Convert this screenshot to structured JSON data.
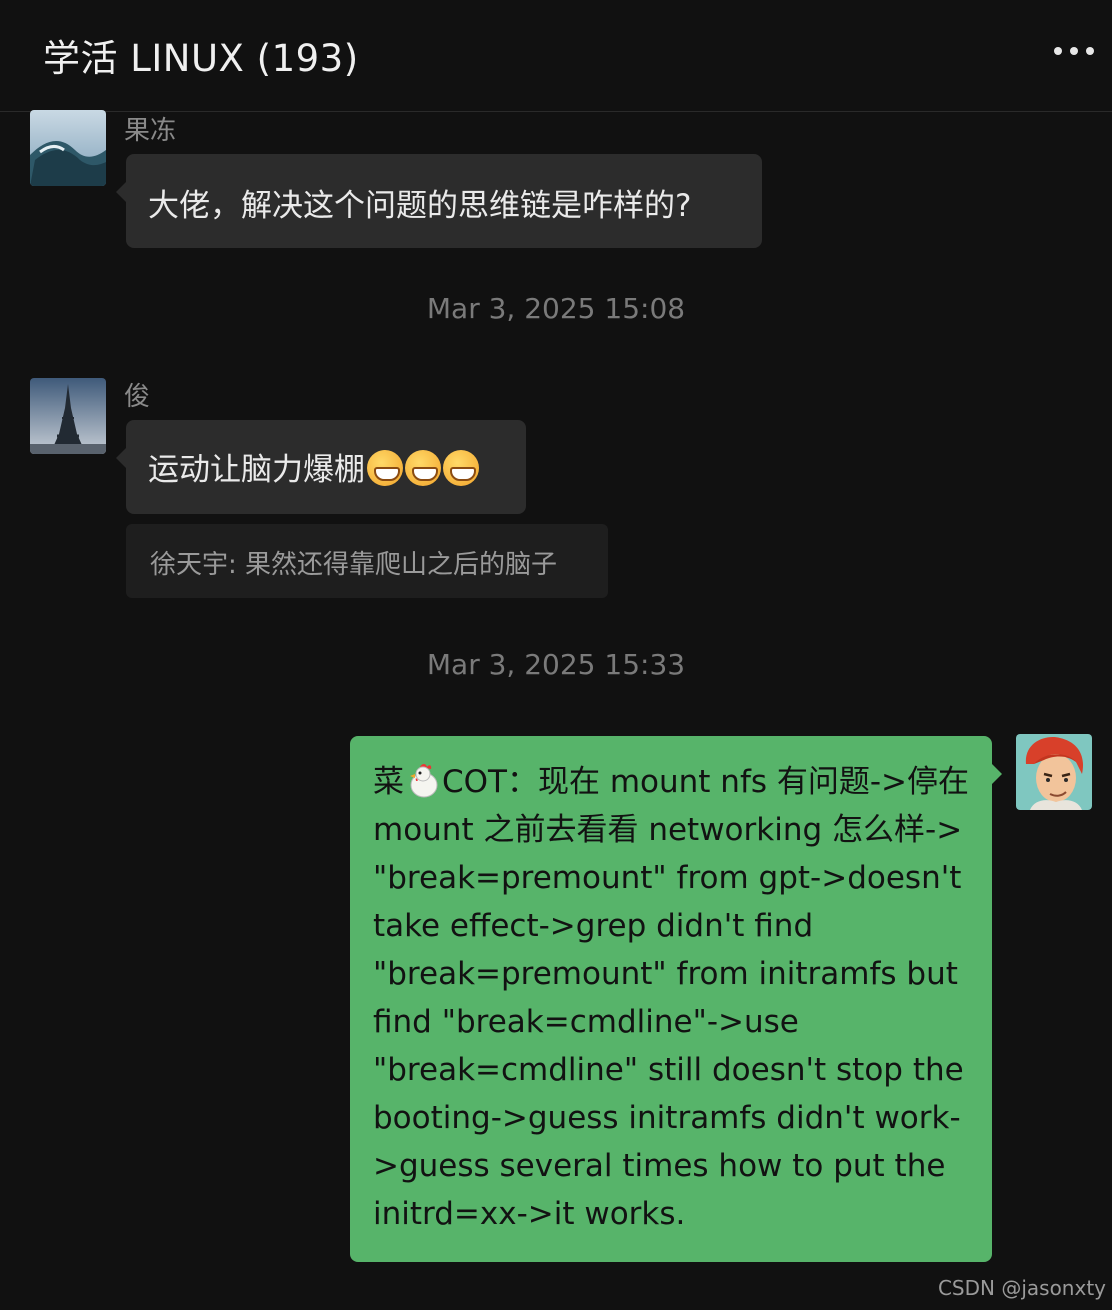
{
  "header": {
    "title": "学活 LINUX  (193)",
    "more_icon": "more-horizontal-icon"
  },
  "messages": [
    {
      "sender": "果冻",
      "text": "大佬，解决这个问题的思维链是咋样的?"
    },
    {
      "timestamp": "Mar 3, 2025 15:08"
    },
    {
      "sender": "俊",
      "text": "运动让脑力爆棚",
      "emoji": "grinning-face-emoji",
      "quote": "徐天宇: 果然还得靠爬山之后的脑子"
    },
    {
      "timestamp": "Mar 3, 2025 15:33"
    },
    {
      "self": true,
      "text_prefix": "菜",
      "chicken_icon": "chicken-icon",
      "text": "COT：现在 mount nfs 有问题->停在 mount 之前去看看 networking 怎么样-> \"break=premount\" from gpt->doesn't take effect->grep didn't find \"break=premount\" from initramfs but find \"break=cmdline\"->use \"break=cmdline\" still doesn't stop the booting->guess initramfs didn't work->guess several times how to put the initrd=xx->it works."
    }
  ],
  "watermark": "CSDN @jasonxty"
}
